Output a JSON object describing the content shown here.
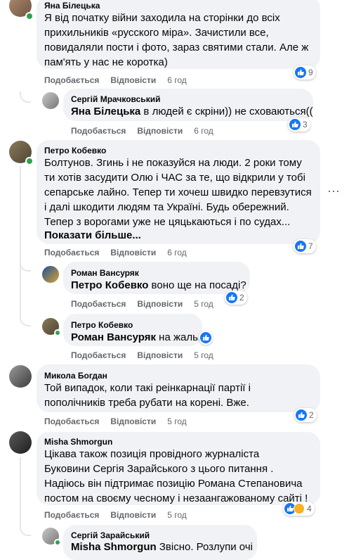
{
  "ui": {
    "like": "Подобається",
    "reply": "Відповісти",
    "colors": {
      "bubble": "#f0f2f5",
      "link": "#1877f2",
      "muted": "#65676b",
      "online": "#31a24c"
    }
  },
  "comments": [
    {
      "author": "Яна Білецька",
      "lines": [
        "Я від початку війни заходила на сторінки до всіх",
        "прихильників «русского міра». Зачистили все,",
        "повидаляли пости і фото, зараз святими стали. Але ж",
        "пам'ять у нас не коротка)"
      ],
      "time": "6 год",
      "reactions": "9",
      "reaction_icons": [
        "like-icon",
        "heart-icon"
      ]
    },
    {
      "author": "Сергій Мрачковський",
      "mention": "Яна Білецька",
      "text": " в людей є скріни)) не сховаються((",
      "time": "6 год",
      "reactions": "3"
    },
    {
      "author": "Петро Кобевко",
      "lines": [
        "Болтунов. Згинь і не показуйся на люди. 2 роки тому",
        "ти хотів засудити Олю і ЧАС за те, що відкрили у тобі",
        "сепарське лайно. Тепер ти хочеш швидко перевзутися",
        "і далі шкодити людям та Україні. Будь обережний.",
        "Тепер з ворогами уже не цяцькаються і по судах..."
      ],
      "see_more": "Показати більше...",
      "time": "6 год",
      "reactions": "7",
      "more_icon": "more-dots-icon"
    },
    {
      "author": "Роман Вансуряк",
      "mention": "Петро Кобевко",
      "text": " воно ще на посаді?",
      "time": "5 год",
      "reactions": "2"
    },
    {
      "author": "Петро Кобевко",
      "mention": "Роман Вансуряк",
      "text": " на жаль.",
      "time": "5 год"
    },
    {
      "author": "Микола Богдан",
      "lines": [
        "Той випадок, коли такі реінкарнації партії і",
        "пополічників треба рубати на корені. Вже."
      ],
      "time": "5 год",
      "reactions": "2"
    },
    {
      "author": "Misha Shmorgun",
      "lines": [
        "Цікава також позиція провідного журналіста",
        "Буковини Сергія Зарайського з цього питання .",
        "Надіюсь він підтримає позицію Романа Степановича",
        "постом на своєму чесному і незаангажованому сайті !"
      ],
      "time": "5 год",
      "reactions": "4"
    },
    {
      "author": "Сергій Зарайський",
      "mention": "Misha Shmorgun",
      "text": " Звісно. Розлупи очі"
    }
  ]
}
